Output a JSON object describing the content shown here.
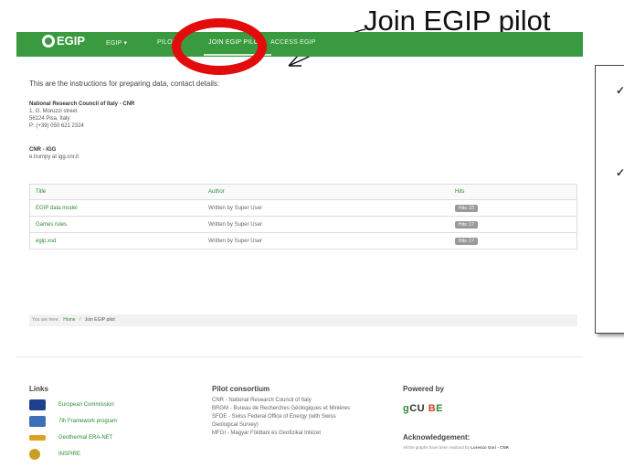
{
  "annotation": {
    "label": "Join EGIP pilot",
    "highlight_color": "#e20c0c"
  },
  "brand": {
    "logo_text": "EGIP",
    "accent": "#3a9a3f"
  },
  "nav": {
    "items": [
      {
        "label": "EGIP ▾"
      },
      {
        "label": "PILOT"
      },
      {
        "label": "JOIN EGIP PILOT"
      },
      {
        "label": "ACCESS EGIP"
      }
    ],
    "active_index": 2
  },
  "content": {
    "intro": "This are the instructions for preparing data, contact details:",
    "org1": {
      "name": "National Research Council of Italy - CNR",
      "lines": [
        "1, G. Moruzzi street",
        "56124 Pisa, Italy",
        "P: (+39) 050 621 2324"
      ]
    },
    "org2": {
      "name": "CNR - IGG",
      "lines": [
        "e.trumpy at igg.cnr.it"
      ]
    },
    "table": {
      "headers": [
        "Title",
        "Author",
        "Hits"
      ],
      "rows": [
        {
          "title": "EGIP data model",
          "author": "Written by Super User",
          "hits": "Hits: 23"
        },
        {
          "title": "Games rules",
          "author": "Written by Super User",
          "hits": "Hits: 17"
        },
        {
          "title": "egip.xsd",
          "author": "Written by Super User",
          "hits": "Hits: 17"
        }
      ]
    },
    "breadcrumb": {
      "prefix": "You are here:",
      "home": "Home",
      "sep": "/",
      "current": "Join EGIP pilot"
    }
  },
  "footer": {
    "links_title": "Links",
    "links": [
      {
        "label": "European Commission",
        "logo_color": "#1f3f8f"
      },
      {
        "label": "7th Framework program",
        "logo_color": "#3b6fb6"
      },
      {
        "label": "Geothermal ERA-NET",
        "logo_color": "#e0a020"
      },
      {
        "label": "INSPIRE",
        "logo_color": "#c8a020"
      }
    ],
    "consortium_title": "Pilot consortium",
    "consortium_lines": [
      "CNR - National Research Council of Italy",
      "BRGM - Bureau de Recherches Géologiques et Minières",
      "SFOE - Swiss Federal Office of Energy (with Swiss",
      "Geological Survey)",
      "MFGI - Magyar Földtani és Geofizikai Intézet"
    ],
    "powered_title": "Powered by",
    "powered_logo": {
      "g": "g",
      "cu": "CU",
      "b": "B",
      "e": "E"
    },
    "ack_title": "Acknowledgement:",
    "ack_text": "All the graphs have been realized by",
    "ack_author": "Lorenzo Gori - CNR"
  }
}
